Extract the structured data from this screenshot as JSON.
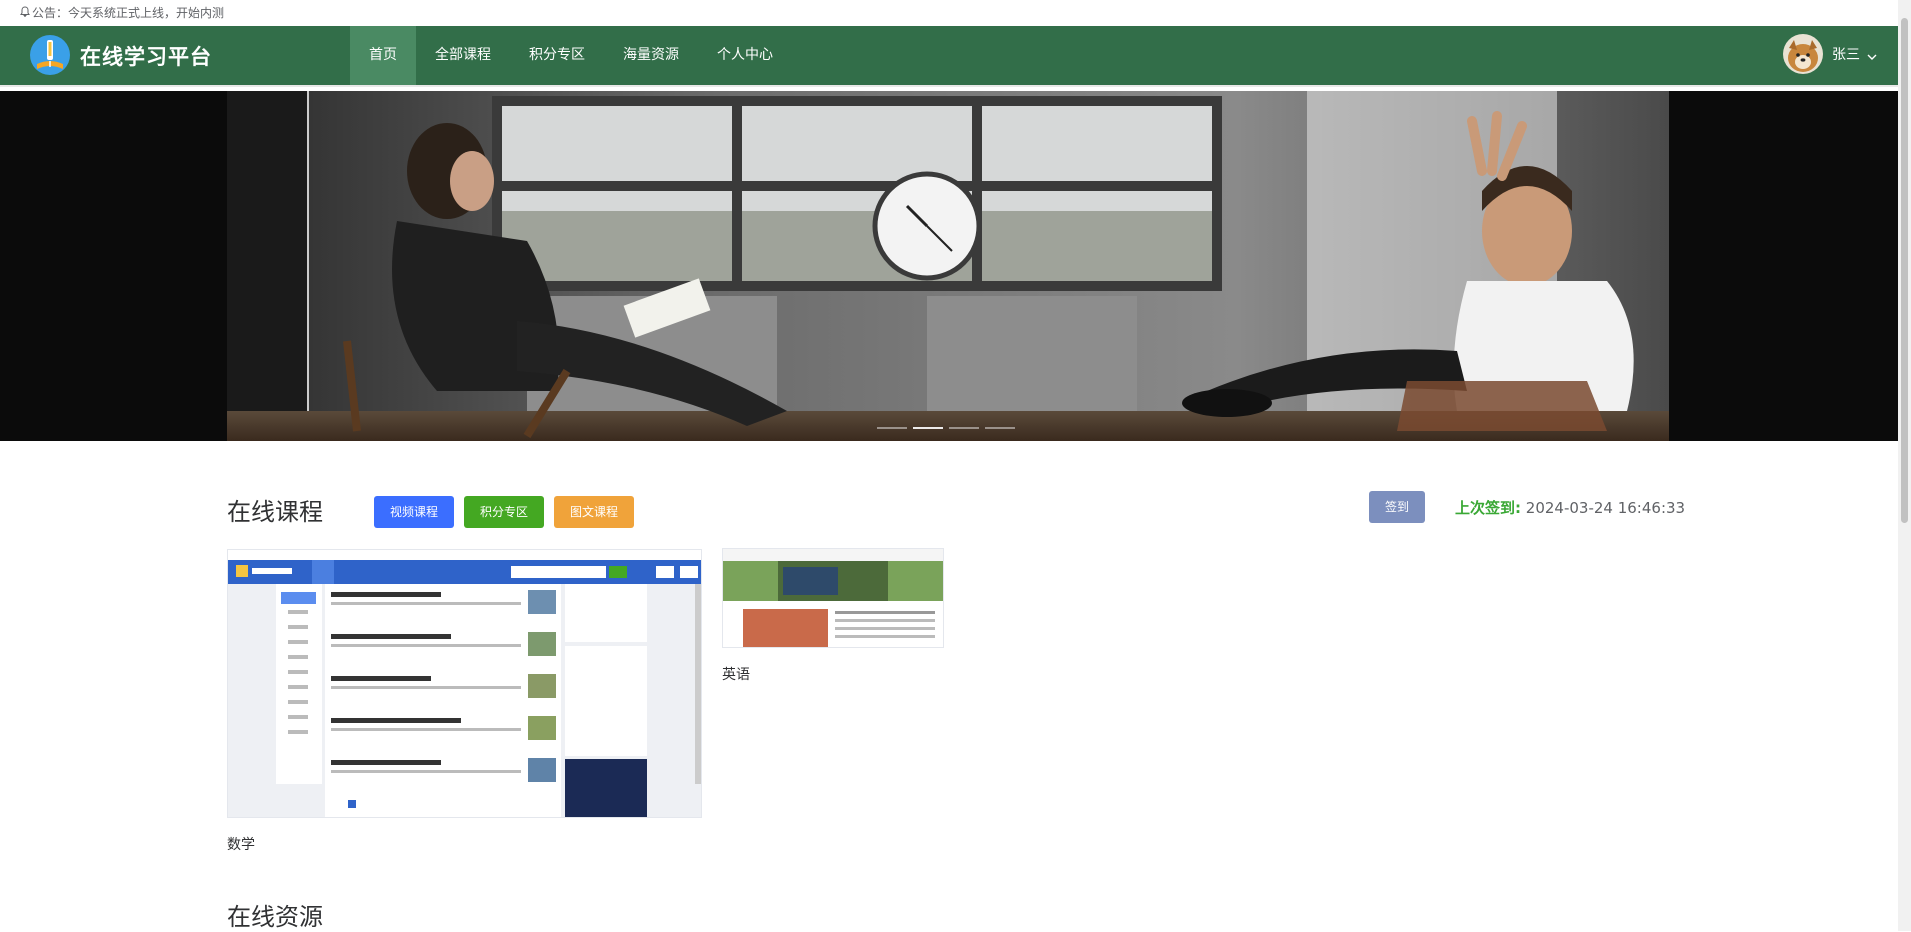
{
  "notice": {
    "icon": "bell-icon",
    "text": "公告：今天系统正式上线，开始内测"
  },
  "header": {
    "site_title": "在线学习平台",
    "nav": [
      "首页",
      "全部课程",
      "积分专区",
      "海量资源",
      "个人中心"
    ],
    "active_nav": 0,
    "user_name": "张三",
    "brand_color": "#326e49"
  },
  "banner": {
    "slide_count": 4,
    "active_slide": 1
  },
  "courses": {
    "title": "在线课程",
    "buttons": {
      "video": "视频课程",
      "points": "积分专区",
      "article": "图文课程"
    },
    "sign_button": "签到",
    "last_sign_label": "上次签到:",
    "last_sign_time": "2024-03-24 16:46:33",
    "items": [
      {
        "name": "数学"
      },
      {
        "name": "英语"
      }
    ]
  },
  "resources": {
    "title": "在线资源"
  }
}
